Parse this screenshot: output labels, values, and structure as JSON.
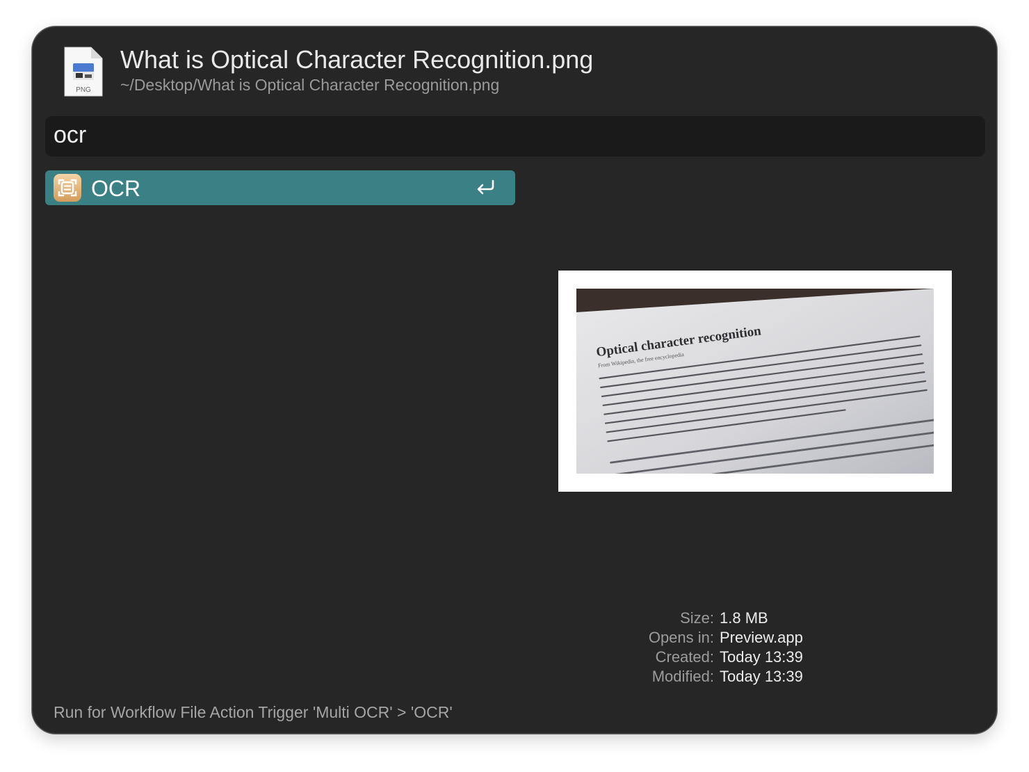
{
  "file": {
    "icon": "png-file-icon",
    "icon_label": "PNG",
    "title": "What is Optical Character Recognition.png",
    "path": "~/Desktop/What is Optical Character Recognition.png"
  },
  "search": {
    "query": "ocr"
  },
  "results": [
    {
      "label": "OCR",
      "icon": "ocr-scan-icon",
      "action_icon": "return-key-icon",
      "selected": true
    }
  ],
  "preview": {
    "image": "document-photo-thumbnail",
    "doc_heading": "Optical character recognition",
    "doc_sub": "From Wikipedia, the free encyclopedia"
  },
  "info": [
    {
      "key": "Size:",
      "value": "1.8 MB"
    },
    {
      "key": "Opens in:",
      "value": "Preview.app"
    },
    {
      "key": "Created:",
      "value": "Today 13:39"
    },
    {
      "key": "Modified:",
      "value": "Today 13:39"
    }
  ],
  "footer": {
    "text": "Run for Workflow File Action Trigger 'Multi OCR' > 'OCR'"
  },
  "colors": {
    "window_bg": "#262626",
    "search_bg": "#1a1a1a",
    "selection": "#3a8085",
    "text_primary": "#e9e9e9",
    "text_secondary": "#9a9a9a"
  }
}
